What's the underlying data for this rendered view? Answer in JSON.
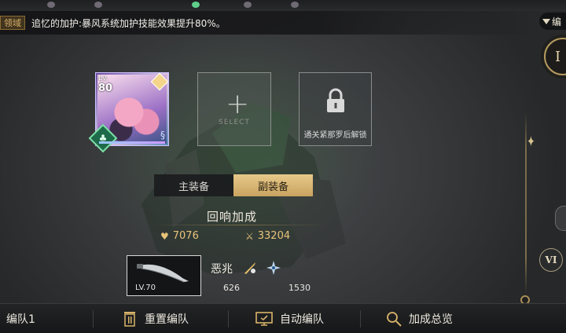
{
  "banner": {
    "tag": "领域",
    "text": "追忆的加护:暴风系统加护技能效果提升80%。"
  },
  "corner_badge": {
    "label": "编"
  },
  "right_rail": {
    "ring_label": "I",
    "stage_label": "VI"
  },
  "slots": {
    "hero": {
      "lv_label": "Lv.",
      "level": "80",
      "element_icon": "diamond-element-icon",
      "role_icon": "green-role-icon"
    },
    "empty": {
      "label": "SELECT",
      "icon": "plus-icon"
    },
    "locked": {
      "label": "通关紧那罗后解锁",
      "icon": "lock-icon"
    }
  },
  "equip_tabs": [
    {
      "label": "主装备",
      "active": false
    },
    {
      "label": "副装备",
      "active": true
    }
  ],
  "bonus": {
    "title": "回响加成",
    "hp": {
      "icon": "heart-icon",
      "value": "7076"
    },
    "atk": {
      "icon": "crossed-swords-icon",
      "value": "33204"
    }
  },
  "weapon": {
    "level": "LV.70",
    "name": "恶兆",
    "stat1": "626",
    "stat2": "1530",
    "icons": [
      "sword-stat-icon",
      "shuriken-stat-icon"
    ]
  },
  "bottom_bar": {
    "team": "编队1",
    "reset": "重置编队",
    "auto": "自动编队",
    "overview": "加成总览"
  },
  "colors": {
    "accent_gold": "#d9b46b",
    "tab_active": "#d9b778",
    "bonus_text": "#e7c27a"
  }
}
